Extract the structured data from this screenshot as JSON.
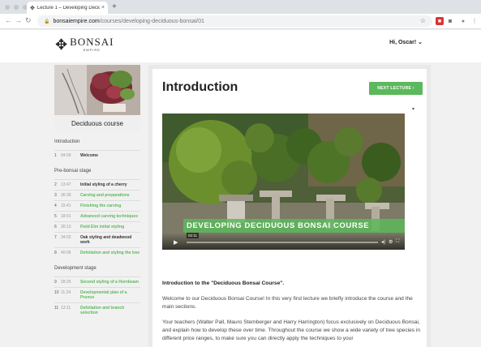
{
  "browser": {
    "tab_title": "Lecture 1 – Developing Decidu",
    "tab_close": "×",
    "new_tab": "+",
    "url_host": "bonsaiempire.com",
    "url_path": "/courses/developing-deciduous-bonsai/01"
  },
  "header": {
    "logo_text": "BONSAI",
    "logo_sub": "EMPIRE",
    "user_greeting": "Hi, Oscar!"
  },
  "sidebar": {
    "course_title": "Deciduous course",
    "sections": [
      {
        "title": "Introduction",
        "lessons": [
          {
            "num": "1",
            "dur": "04:09",
            "title": "Welcome",
            "done": false
          }
        ]
      },
      {
        "title": "Pre-bonsai stage",
        "lessons": [
          {
            "num": "2",
            "dur": "13:47",
            "title": "Initial styling of a cherry",
            "done": false
          },
          {
            "num": "3",
            "dur": "36:39",
            "title": "Carving and preparations",
            "done": true
          },
          {
            "num": "4",
            "dur": "15:41",
            "title": "Finishing the carving",
            "done": true
          },
          {
            "num": "5",
            "dur": "18:01",
            "title": "Advanced carving techniques",
            "done": true
          },
          {
            "num": "6",
            "dur": "30:13",
            "title": "Field Elm initial styling",
            "done": true
          },
          {
            "num": "7",
            "dur": "34:02",
            "title": "Oak styling and deadwood work",
            "done": false
          },
          {
            "num": "8",
            "dur": "40:06",
            "title": "Defoliation and styling the tree",
            "done": true
          }
        ]
      },
      {
        "title": "Development stage",
        "lessons": [
          {
            "num": "9",
            "dur": "28:25",
            "title": "Second styling of a Hornbeam",
            "done": true
          },
          {
            "num": "10",
            "dur": "11:24",
            "title": "Developmental plan of a Prunus",
            "done": true
          },
          {
            "num": "11",
            "dur": "13:11",
            "title": "Defoliation and branch selection",
            "done": true
          }
        ]
      }
    ]
  },
  "main": {
    "title": "Introduction",
    "next_button": "NEXT LECTURE ›",
    "video": {
      "banner": "DEVELOPING DECIDUOUS BONSAI COURSE",
      "time": "02:11",
      "progress": 0
    },
    "paragraphs": [
      "Introduction to the \"Deciduous Bonsai Course\".",
      "Welcome to our Deciduous Bonsai Course! In this very first lecture we briefly introduce the course and the main sections.",
      "Your teachers (Walter Pall, Mauro Stemberger and Harry Harrington) focus exclusively on Deciduous Bonsai, and explain how to develop these over time. Throughout the course we show a wide variety of tree species in different price ranges, to make sure you can directly apply the techniques to your"
    ]
  },
  "colors": {
    "accent_green": "#5cb85c",
    "page_bg": "#f1f1f1"
  },
  "icons": [
    "back-icon",
    "forward-icon",
    "reload-icon",
    "home-icon",
    "lock-icon",
    "star-icon",
    "play-icon",
    "volume-icon",
    "settings-icon",
    "fullscreen-icon"
  ]
}
